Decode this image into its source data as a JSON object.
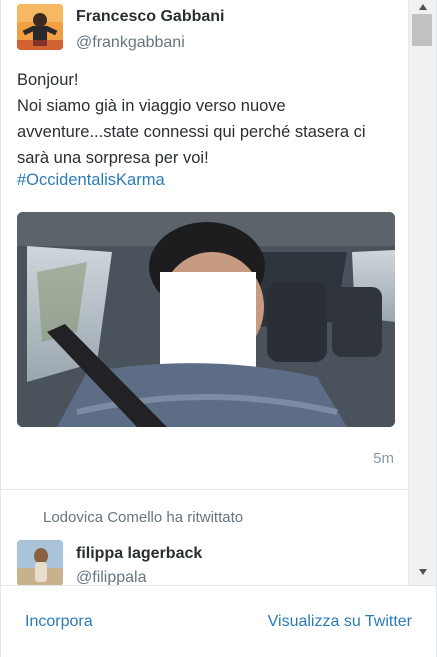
{
  "tweets": [
    {
      "author_name": "Francesco Gabbani",
      "author_handle": "@frankgabbani",
      "text": "Bonjour!\nNoi siamo già in viaggio verso nuove avventure...state connessi qui perché stasera ci sarà una sorpresa per voi!",
      "hashtag": "#OccidentalisKarma",
      "timestamp": "5m"
    }
  ],
  "retweet": {
    "context": "Lodovica Comello ha ritwittato",
    "author_name": "filippa lagerback",
    "author_handle": "@filippala"
  },
  "footer": {
    "embed_label": "Incorpora",
    "view_label": "Visualizza su Twitter"
  },
  "colors": {
    "link": "#2b7bb9",
    "text": "#292f33",
    "muted": "#66757f",
    "divider": "#e1e8ed"
  },
  "icons": [
    "scroll-up-arrow-icon",
    "scroll-down-arrow-icon"
  ]
}
